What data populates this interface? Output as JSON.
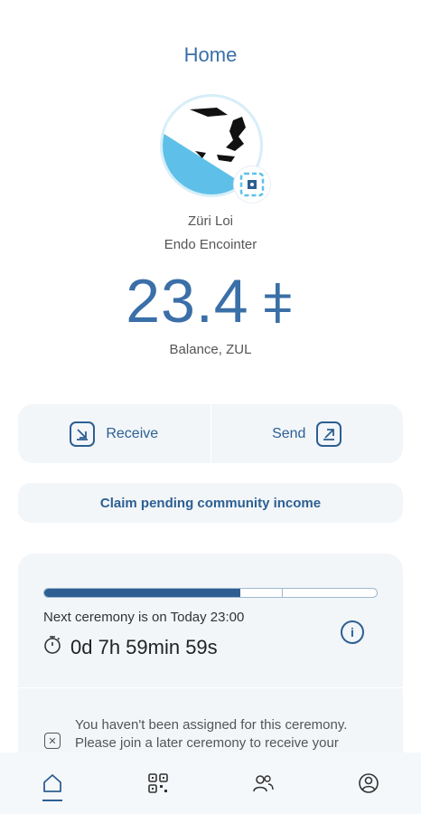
{
  "header": {
    "title": "Home"
  },
  "community": {
    "name": "Züri Loi",
    "encointer": "Endo Encointer"
  },
  "balance": {
    "amount": "23.4",
    "currency_symbol": "⧧",
    "label": "Balance, ZUL"
  },
  "actions": {
    "receive_label": "Receive",
    "send_label": "Send"
  },
  "claim": {
    "label": "Claim pending community income"
  },
  "ceremony": {
    "progress": 0.59,
    "next_label": "Next ceremony is on Today 23:00",
    "countdown": "0d 7h 59min 59s",
    "notice": "You haven't been assigned for this ceremony. Please join a later ceremony to receive your"
  },
  "nav": [
    {
      "icon": "home-icon",
      "active": true
    },
    {
      "icon": "qr-code-icon",
      "active": false
    },
    {
      "icon": "contacts-icon",
      "active": false
    },
    {
      "icon": "profile-icon",
      "active": false
    }
  ],
  "colors": {
    "accent": "#2d5f92",
    "title": "#3a6fa8",
    "card_bg": "#f2f6f9",
    "avatar_blue": "#5ec0e8"
  }
}
